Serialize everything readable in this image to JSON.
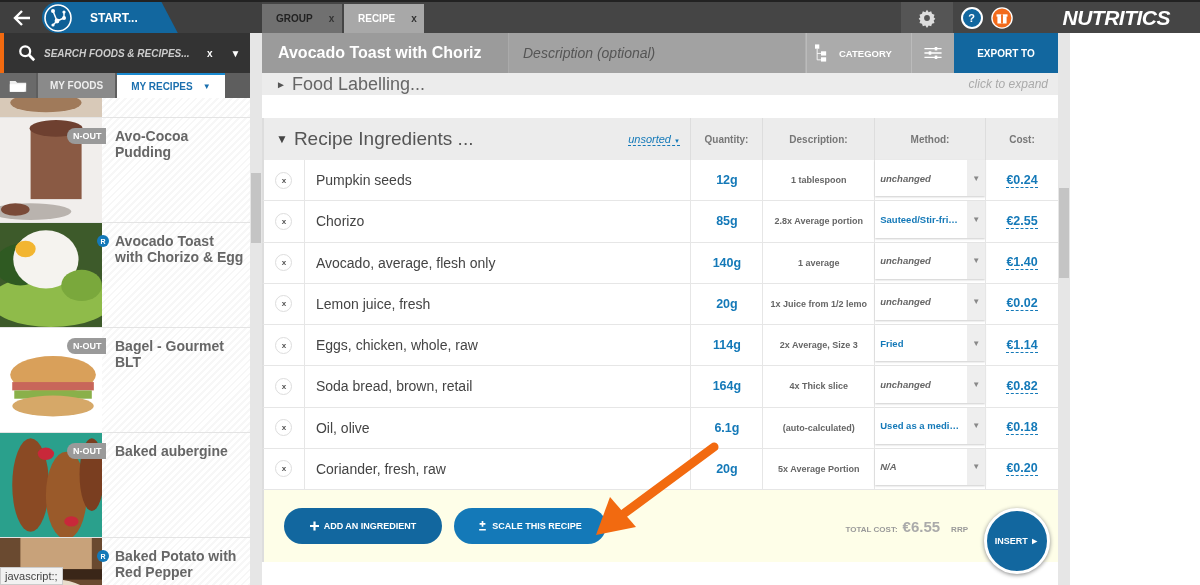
{
  "start_button": "START...",
  "search": {
    "placeholder": "SEARCH FOODS & RECIPES...",
    "clear": "x",
    "menu": "▼"
  },
  "sidebar_tabs": [
    {
      "label": "MY FOODS",
      "selected": false
    },
    {
      "label": "MY RECIPES",
      "selected": true,
      "caret": "▼"
    }
  ],
  "sidebar_items": [
    {
      "name": "Avo-Cocoa Pudding",
      "badge": {
        "kind": "n-out",
        "text": "N-OUT"
      }
    },
    {
      "name": "Avocado Toast with Chorizo & Egg",
      "badge": {
        "kind": "r",
        "text": "R"
      }
    },
    {
      "name": "Bagel - Gourmet BLT",
      "badge": {
        "kind": "n-out",
        "text": "N-OUT"
      }
    },
    {
      "name": "Baked aubergine",
      "badge": {
        "kind": "n-out",
        "text": "N-OUT"
      }
    },
    {
      "name": "Baked Potato with Red Pepper",
      "badge": {
        "kind": "r",
        "text": "R"
      }
    }
  ],
  "tabs": [
    {
      "label": "GROUP",
      "selected": false,
      "close": "x"
    },
    {
      "label": "RECIPE",
      "selected": true,
      "close": "x"
    }
  ],
  "help": "?",
  "logo": "NUTRITICS",
  "recipe": {
    "title": "Avocado Toast with Choriz",
    "description_placeholder": "Description (optional)",
    "category": "CATEGORY",
    "export": "EXPORT TO"
  },
  "food_labelling": {
    "arrow": "►",
    "label": "Food Labelling...",
    "hint": "click to expand"
  },
  "ingredients": {
    "arrow": "▼",
    "title": "Recipe Ingredients ...",
    "sort": "unsorted",
    "columns": [
      "Quantity:",
      "Description:",
      "Method:",
      "Cost:"
    ],
    "rows": [
      {
        "remove": "x",
        "name": "Pumpkin seeds",
        "quantity": "12g",
        "description": "1 tablespoon",
        "method": "unchanged",
        "method_set": false,
        "cost": "€0.24"
      },
      {
        "remove": "x",
        "name": "Chorizo",
        "quantity": "85g",
        "description": "2.8x Average portion",
        "method": "Sauteed/Stir-fri…",
        "method_set": true,
        "cost": "€2.55"
      },
      {
        "remove": "x",
        "name": "Avocado, average, flesh only",
        "quantity": "140g",
        "description": "1 average",
        "method": "unchanged",
        "method_set": false,
        "cost": "€1.40"
      },
      {
        "remove": "x",
        "name": "Lemon juice, fresh",
        "quantity": "20g",
        "description": "1x Juice from 1/2 lemo",
        "method": "unchanged",
        "method_set": false,
        "cost": "€0.02"
      },
      {
        "remove": "x",
        "name": "Eggs, chicken, whole, raw",
        "quantity": "114g",
        "description": "2x Average, Size 3",
        "method": "Fried",
        "method_set": true,
        "cost": "€1.14"
      },
      {
        "remove": "x",
        "name": "Soda bread, brown, retail",
        "quantity": "164g",
        "description": "4x Thick slice",
        "method": "unchanged",
        "method_set": false,
        "cost": "€0.82"
      },
      {
        "remove": "x",
        "name": "Oil, olive",
        "quantity": "6.1g",
        "description": "(auto-calculated)",
        "method": "Used as a medi…",
        "method_set": true,
        "cost": "€0.18"
      },
      {
        "remove": "x",
        "name": "Coriander, fresh, raw",
        "quantity": "20g",
        "description": "5x Average Portion",
        "method": "N/A",
        "method_set": false,
        "cost": "€0.20"
      }
    ],
    "dropdown": "▼"
  },
  "footer": {
    "add": "ADD AN INGREDIENT",
    "scale": "SCALE THIS RECIPE",
    "total_label": "TOTAL COST:",
    "total": "€6.55",
    "rrp": "RRP",
    "insert": "INSERT ►"
  },
  "status_tooltip": "javascript:;"
}
